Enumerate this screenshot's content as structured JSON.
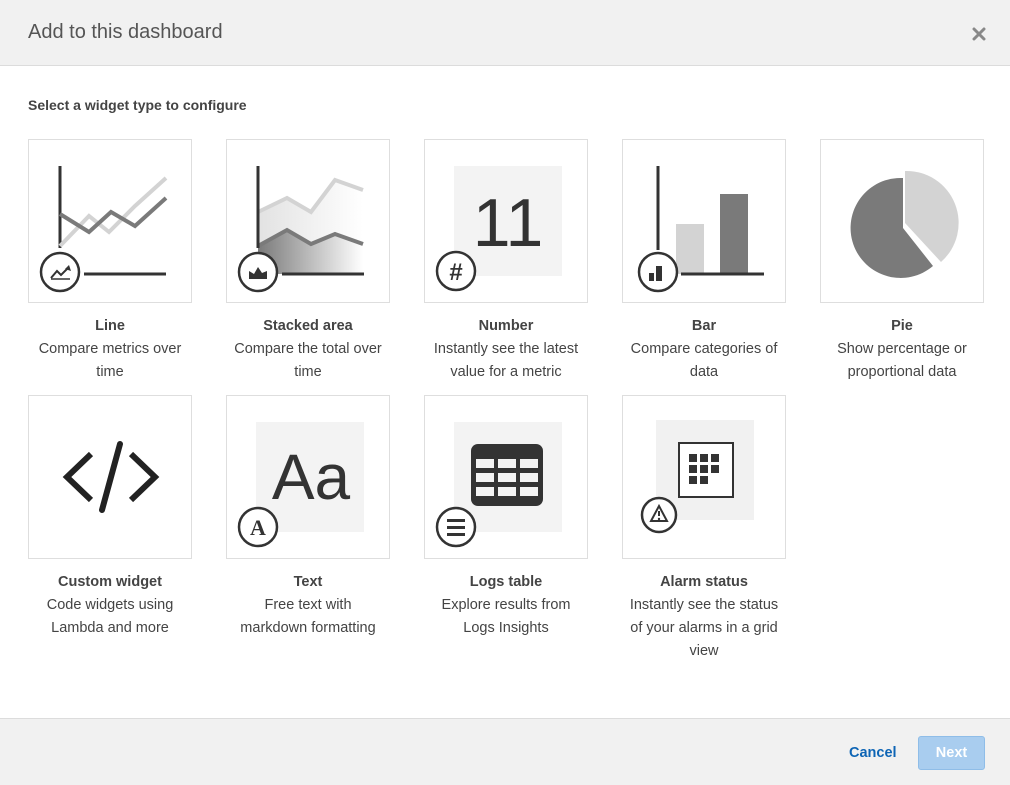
{
  "header": {
    "title": "Add to this dashboard"
  },
  "instructions": "Select a widget type to configure",
  "widgets": [
    {
      "name": "Line",
      "desc_line1": "Compare metrics over",
      "desc_line2": "time",
      "icon": "line-chart-icon"
    },
    {
      "name": "Stacked area",
      "desc_line1": "Compare the total over",
      "desc_line2": "time",
      "icon": "stacked-area-icon"
    },
    {
      "name": "Number",
      "desc_line1": "Instantly see the latest",
      "desc_line2": "value for a metric",
      "icon": "number-icon",
      "sample_value": "11"
    },
    {
      "name": "Bar",
      "desc_line1": "Compare categories of",
      "desc_line2": "data",
      "icon": "bar-chart-icon"
    },
    {
      "name": "Pie",
      "desc_line1": "Show percentage or",
      "desc_line2": "proportional data",
      "icon": "pie-chart-icon"
    },
    {
      "name": "Custom widget",
      "desc_line1": "Code widgets using",
      "desc_line2": "Lambda and more",
      "icon": "code-icon"
    },
    {
      "name": "Text",
      "desc_line1": "Free text with",
      "desc_line2": "markdown formatting",
      "icon": "text-icon",
      "sample_text": "Aa"
    },
    {
      "name": "Logs table",
      "desc_line1": "Explore results from",
      "desc_line2": "Logs Insights",
      "icon": "table-icon"
    },
    {
      "name": "Alarm status",
      "desc_line1": "Instantly see the status",
      "desc_line2": "of your alarms in a grid",
      "desc_line3": "view",
      "icon": "alarm-grid-icon"
    }
  ],
  "footer": {
    "cancel_label": "Cancel",
    "next_label": "Next"
  },
  "colors": {
    "accent": "#0e65b5",
    "next_disabled": "#a9cdef",
    "dark": "#333333",
    "mid_gray": "#7a7a7a",
    "light_gray": "#d3d3d3"
  }
}
